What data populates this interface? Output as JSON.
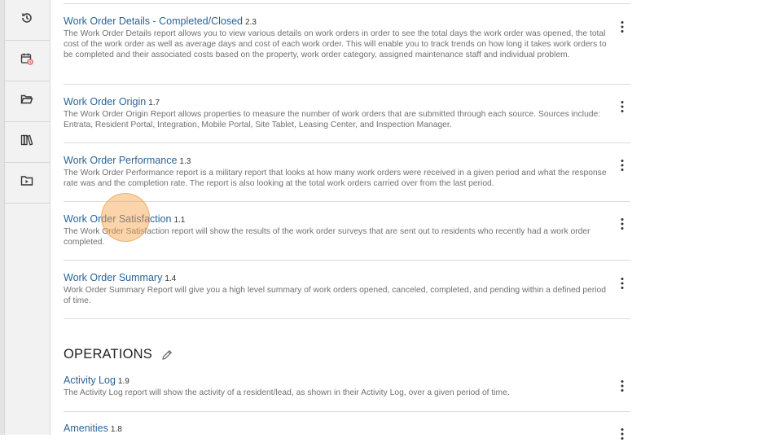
{
  "sidebar": {
    "items": [
      {
        "icon": "history-icon"
      },
      {
        "icon": "calendar-clock-icon"
      },
      {
        "icon": "folder-open-icon"
      },
      {
        "icon": "library-icon"
      },
      {
        "icon": "folder-play-icon"
      }
    ]
  },
  "reports": [
    {
      "title": "Work Order Details - Completed/Closed",
      "version": "2.3",
      "description": "The Work Order Details report allows you to view various details on work orders in order to see the total days the work order was opened, the total cost of the work order as well as average days and cost of each work order. This will enable you to track trends on how long it takes work orders to be completed and their associated costs based on the property, work order category, assigned maintenance staff and individual problem."
    },
    {
      "title": "Work Order Origin",
      "version": "1.7",
      "description": "The Work Order Origin Report allows properties to measure the number of work orders that are submitted through each source. Sources include: Entrata, Resident Portal, Integration, Mobile Portal, Site Tablet, Leasing Center, and Inspection Manager."
    },
    {
      "title": "Work Order Performance",
      "version": "1.3",
      "description": "The Work Order Performance report is a military report that looks at how many work orders were received in a given period and what the response rate was and the completion rate. The report is also looking at the total work orders carried over from the last period."
    },
    {
      "title": "Work Order Satisfaction",
      "version": "1.1",
      "description": "The Work Order Satisfaction report will show the results of the work order surveys that are sent out to residents who recently had a work order completed."
    },
    {
      "title": "Work Order Summary",
      "version": "1.4",
      "description": "Work Order Summary Report will give you a high level summary of work orders opened, canceled, completed, and pending within a defined period of time."
    }
  ],
  "operations": {
    "heading": "OPERATIONS",
    "reports": [
      {
        "title": "Activity Log",
        "version": "1.9",
        "description": "The Activity Log report will show the activity of a resident/lead, as shown in their Activity Log, over a given period of time."
      },
      {
        "title": "Amenities",
        "version": "1.8",
        "description": ""
      }
    ]
  }
}
